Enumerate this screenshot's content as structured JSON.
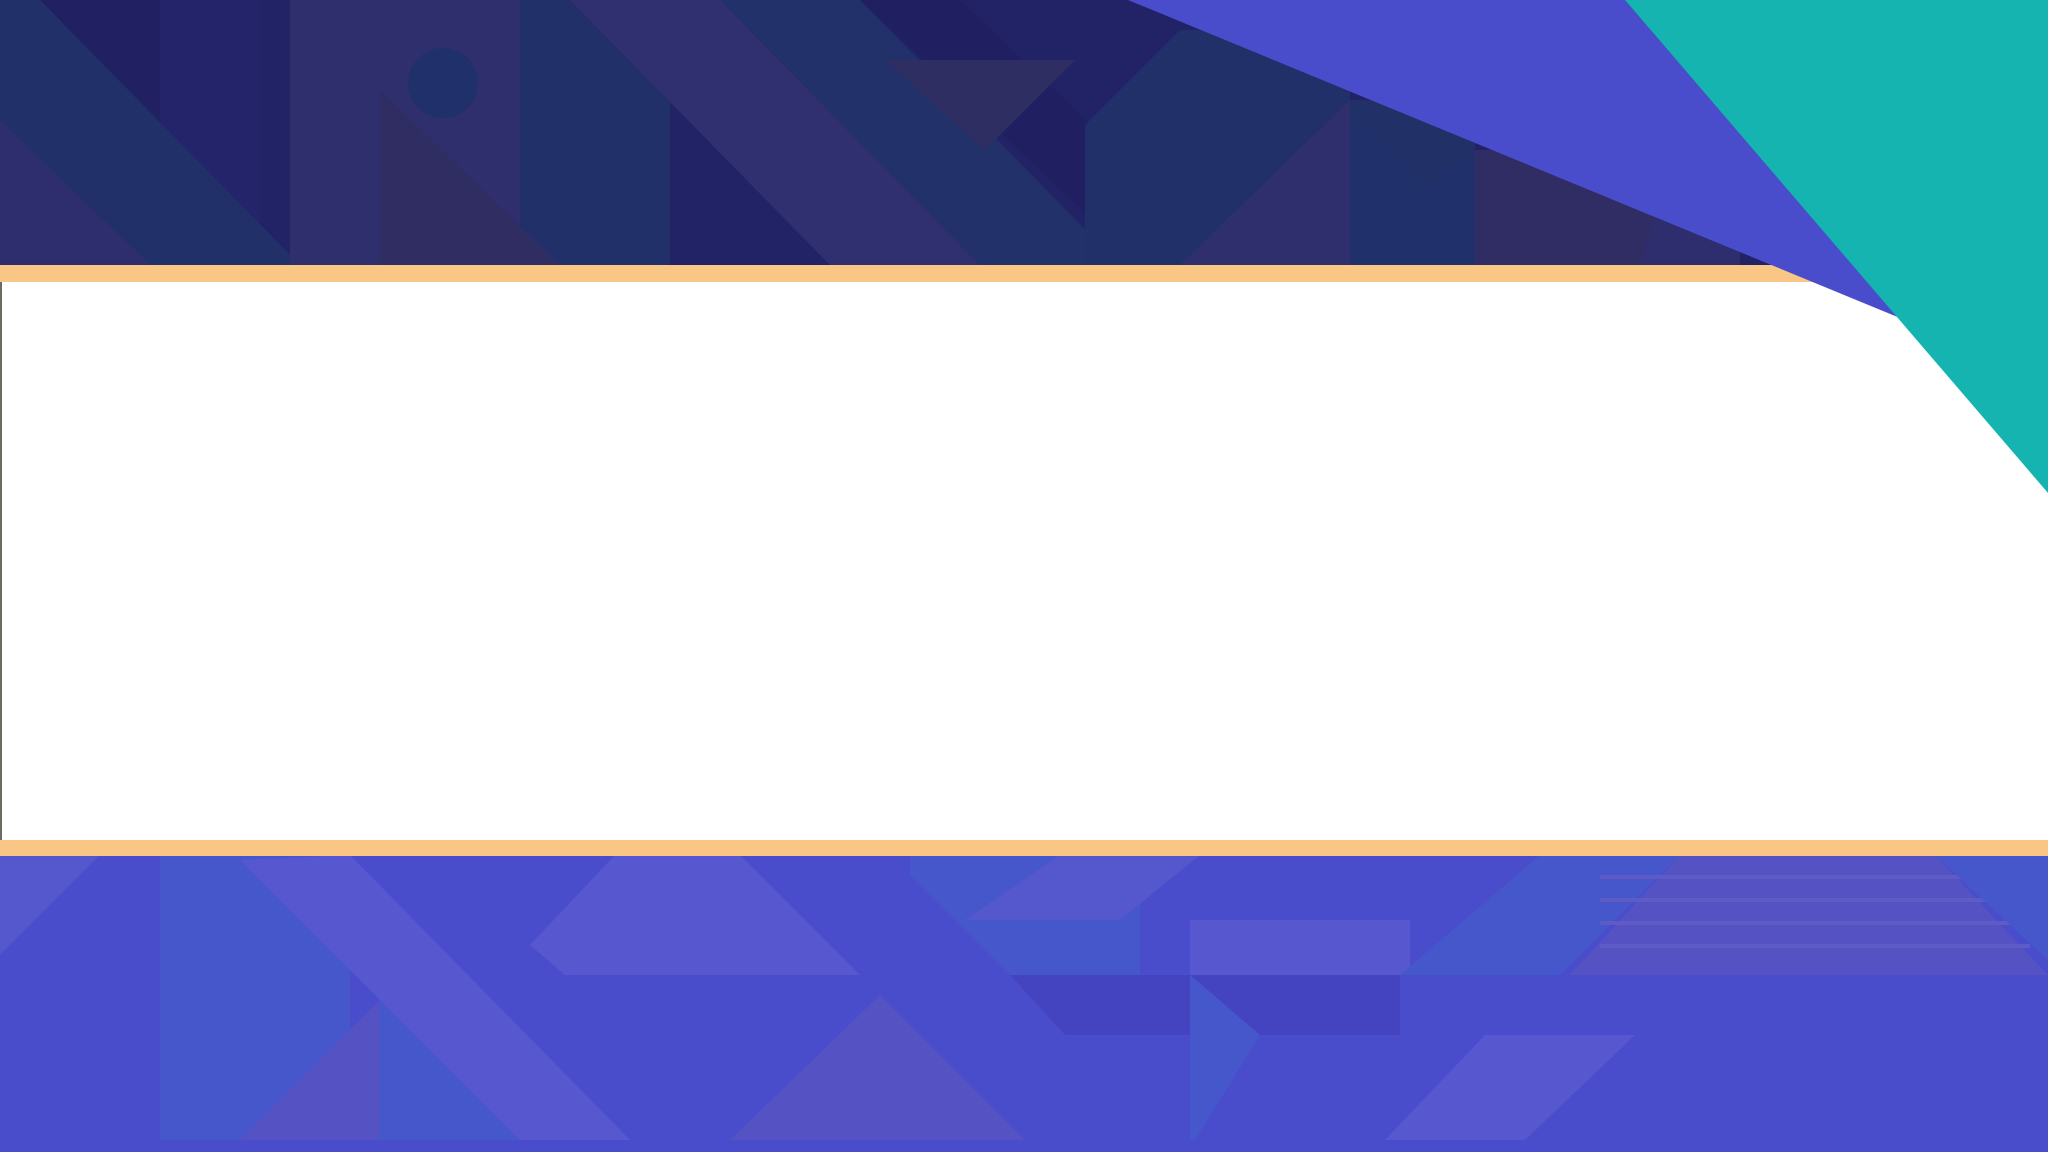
{
  "slide": {
    "title": "",
    "subtitle": ""
  },
  "colors": {
    "top_band": "#222266",
    "bottom_band": "#4a4dcb",
    "accent_stripe": "#f9c686",
    "content_panel": "#ffffff",
    "corner_purple": "#4a4dcb",
    "corner_teal": "#15b4b0"
  }
}
